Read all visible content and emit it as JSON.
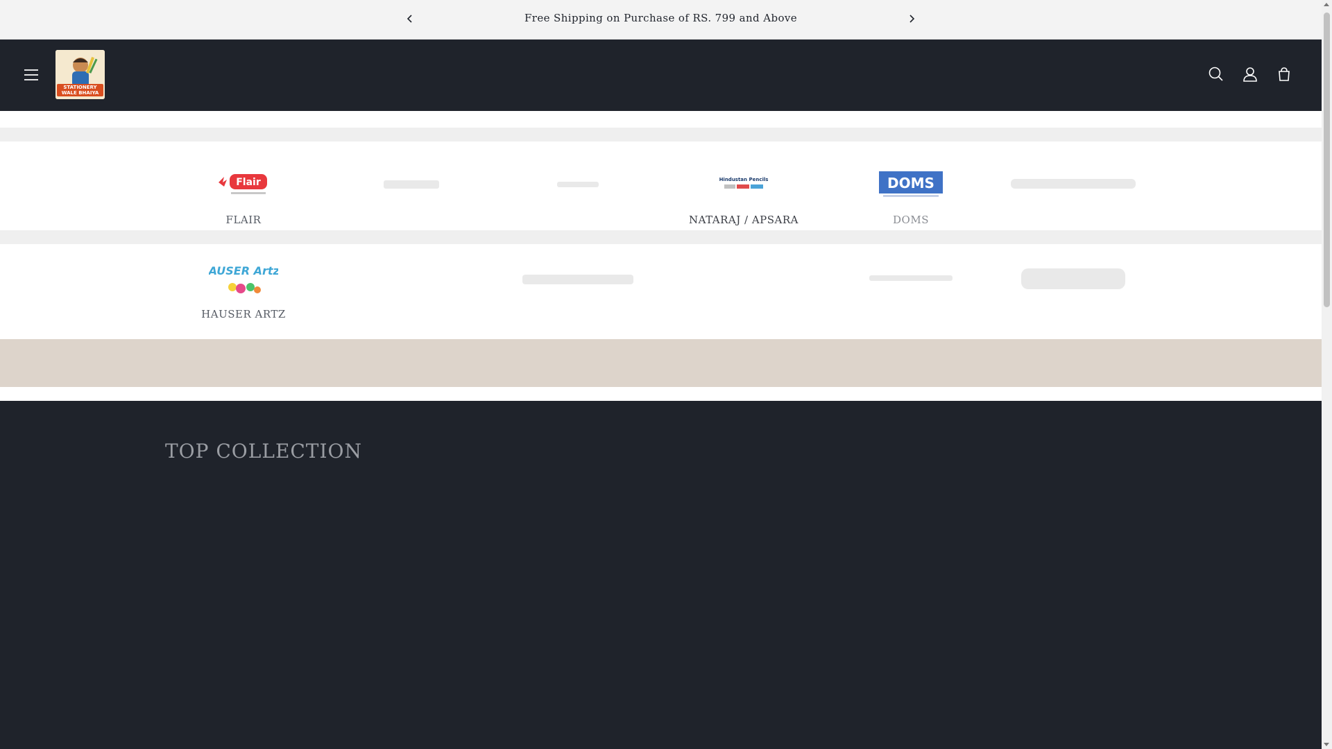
{
  "announcement": {
    "text": "Free Shipping on Purchase of RS. 799 and Above",
    "prev_icon": "chevron-left-icon",
    "next_icon": "chevron-right-icon"
  },
  "header": {
    "logo_text": "STATIONERY WALE BHAIYA",
    "menu_icon": "hamburger-icon",
    "icons": [
      "search-icon",
      "account-icon",
      "cart-icon"
    ]
  },
  "brands": {
    "row1": [
      {
        "name": "FLAIR",
        "logo_text": "Flair"
      },
      {
        "name": "",
        "logo_text": ""
      },
      {
        "name": "",
        "logo_text": ""
      },
      {
        "name": "NATARAJ / APSARA",
        "logo_text": "Hindustan Pencils"
      },
      {
        "name": "DOMS",
        "logo_text": "DOMS"
      },
      {
        "name": "",
        "logo_text": ""
      }
    ],
    "row2": [
      {
        "name": "HAUSER ARTZ",
        "logo_text": "HAUSER Artz"
      },
      {
        "name": "",
        "logo_text": ""
      },
      {
        "name": "",
        "logo_text": ""
      },
      {
        "name": "",
        "logo_text": ""
      },
      {
        "name": "",
        "logo_text": ""
      },
      {
        "name": "",
        "logo_text": ""
      }
    ]
  },
  "main": {
    "section_title": "TOP COLLECTION"
  },
  "colors": {
    "header_bg": "#1f232b",
    "announce_bg": "#f3f3f3",
    "cream_band": "#ddd4cb"
  }
}
